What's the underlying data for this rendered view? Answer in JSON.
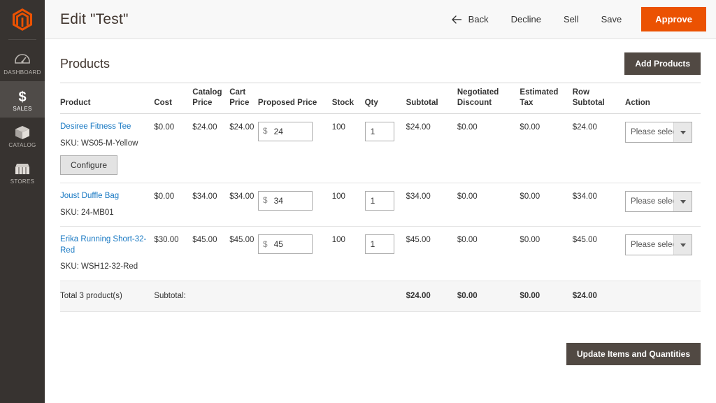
{
  "sidebar": {
    "logo": "magento-logo",
    "items": [
      {
        "label": "DASHBOARD",
        "icon": "dashboard-icon",
        "active": false
      },
      {
        "label": "SALES",
        "icon": "dollar-icon",
        "active": true
      },
      {
        "label": "CATALOG",
        "icon": "box-icon",
        "active": false
      },
      {
        "label": "STORES",
        "icon": "store-icon",
        "active": false
      }
    ]
  },
  "header": {
    "title": "Edit \"Test\"",
    "back_label": "Back",
    "decline_label": "Decline",
    "sell_label": "Sell",
    "save_label": "Save",
    "approve_label": "Approve",
    "approve_color": "#eb5202"
  },
  "section": {
    "title": "Products",
    "add_products_label": "Add Products",
    "update_items_label": "Update Items and Quantities"
  },
  "table": {
    "columns": [
      "Product",
      "Cost",
      "Catalog Price",
      "Cart Price",
      "Proposed Price",
      "Stock",
      "Qty",
      "Subtotal",
      "Negotiated Discount",
      "Estimated Tax",
      "Row Subtotal",
      "Action"
    ],
    "rows": [
      {
        "name": "Desiree Fitness Tee",
        "sku": "SKU: WS05-M-Yellow",
        "configure_label": "Configure",
        "has_configure": true,
        "cost": "$0.00",
        "catalog_price": "$24.00",
        "cart_price": "$24.00",
        "proposed_currency": "$",
        "proposed_price": "24",
        "stock": "100",
        "qty": "1",
        "subtotal": "$24.00",
        "negotiated_discount": "$0.00",
        "estimated_tax": "$0.00",
        "row_subtotal": "$24.00",
        "action": "Please select"
      },
      {
        "name": "Joust Duffle Bag",
        "sku": "SKU: 24-MB01",
        "configure_label": "",
        "has_configure": false,
        "cost": "$0.00",
        "catalog_price": "$34.00",
        "cart_price": "$34.00",
        "proposed_currency": "$",
        "proposed_price": "34",
        "stock": "100",
        "qty": "1",
        "subtotal": "$34.00",
        "negotiated_discount": "$0.00",
        "estimated_tax": "$0.00",
        "row_subtotal": "$34.00",
        "action": "Please select"
      },
      {
        "name": "Erika Running Short-32-Red",
        "sku": "SKU: WSH12-32-Red",
        "configure_label": "",
        "has_configure": false,
        "cost": "$30.00",
        "catalog_price": "$45.00",
        "cart_price": "$45.00",
        "proposed_currency": "$",
        "proposed_price": "45",
        "stock": "100",
        "qty": "1",
        "subtotal": "$45.00",
        "negotiated_discount": "$0.00",
        "estimated_tax": "$0.00",
        "row_subtotal": "$45.00",
        "action": "Please select"
      }
    ],
    "totals": {
      "count_label": "Total 3 product(s)",
      "subtotal_label": "Subtotal:",
      "subtotal": "$24.00",
      "negotiated_discount": "$0.00",
      "estimated_tax": "$0.00",
      "row_subtotal": "$24.00"
    }
  }
}
